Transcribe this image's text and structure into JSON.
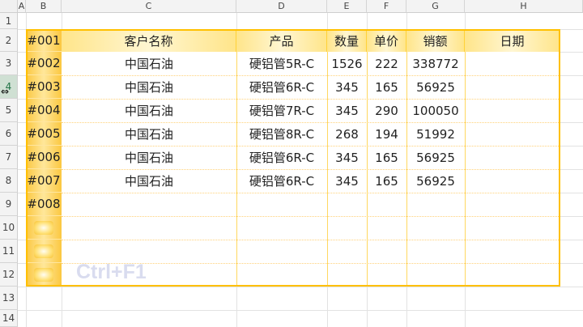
{
  "columns": [
    "A",
    "B",
    "C",
    "D",
    "E",
    "F",
    "G",
    "H"
  ],
  "rows": [
    "1",
    "2",
    "3",
    "4",
    "5",
    "6",
    "7",
    "8",
    "9",
    "10",
    "11",
    "12",
    "13",
    "14"
  ],
  "table": {
    "headers": [
      "客户名称",
      "产品",
      "数量",
      "单价",
      "销额",
      "日期"
    ],
    "ids": [
      "#001",
      "#002",
      "#003",
      "#004",
      "#005",
      "#006",
      "#007",
      "#008"
    ],
    "rows": [
      [
        "中国石油",
        "硬铝管5R-C",
        "1526",
        "222",
        "338772",
        ""
      ],
      [
        "中国石油",
        "硬铝管6R-C",
        "345",
        "165",
        "56925",
        ""
      ],
      [
        "中国石油",
        "硬铝管7R-C",
        "345",
        "290",
        "100050",
        ""
      ],
      [
        "中国石油",
        "硬铝管8R-C",
        "268",
        "194",
        "51992",
        ""
      ],
      [
        "中国石油",
        "硬铝管6R-C",
        "345",
        "165",
        "56925",
        ""
      ],
      [
        "中国石油",
        "硬铝管6R-C",
        "345",
        "165",
        "56925",
        ""
      ]
    ]
  },
  "overlay": {
    "shortcut": "Ctrl+F1"
  },
  "cursor_icon": "row-resize-cursor-icon",
  "accent_color": "#ffc000"
}
